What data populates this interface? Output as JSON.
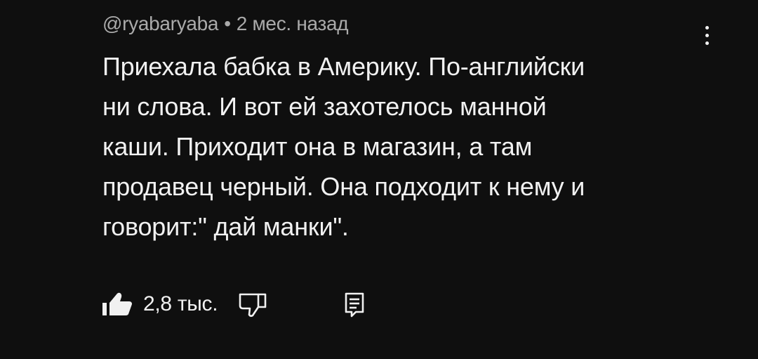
{
  "comment": {
    "author": "@ryabaryaba",
    "separator": "•",
    "time": "2 мес. назад",
    "text_lines": [
      "Приехала бабка в Америку. По-английски",
      "ни слова. И вот ей захотелось манной",
      "каши. Приходит она в магазин, а там",
      "продавец черный. Она подходит к нему и",
      "говорит:\" дай манки\"."
    ],
    "like_count": "2,8 тыс."
  },
  "icons": {
    "like": "thumbs-up-icon",
    "dislike": "thumbs-down-icon",
    "reply": "reply-comment-icon",
    "menu": "more-vertical-icon"
  },
  "colors": {
    "background": "#0f0f0f",
    "text": "#f1f1f1",
    "secondary_text": "#aaaaaa"
  }
}
